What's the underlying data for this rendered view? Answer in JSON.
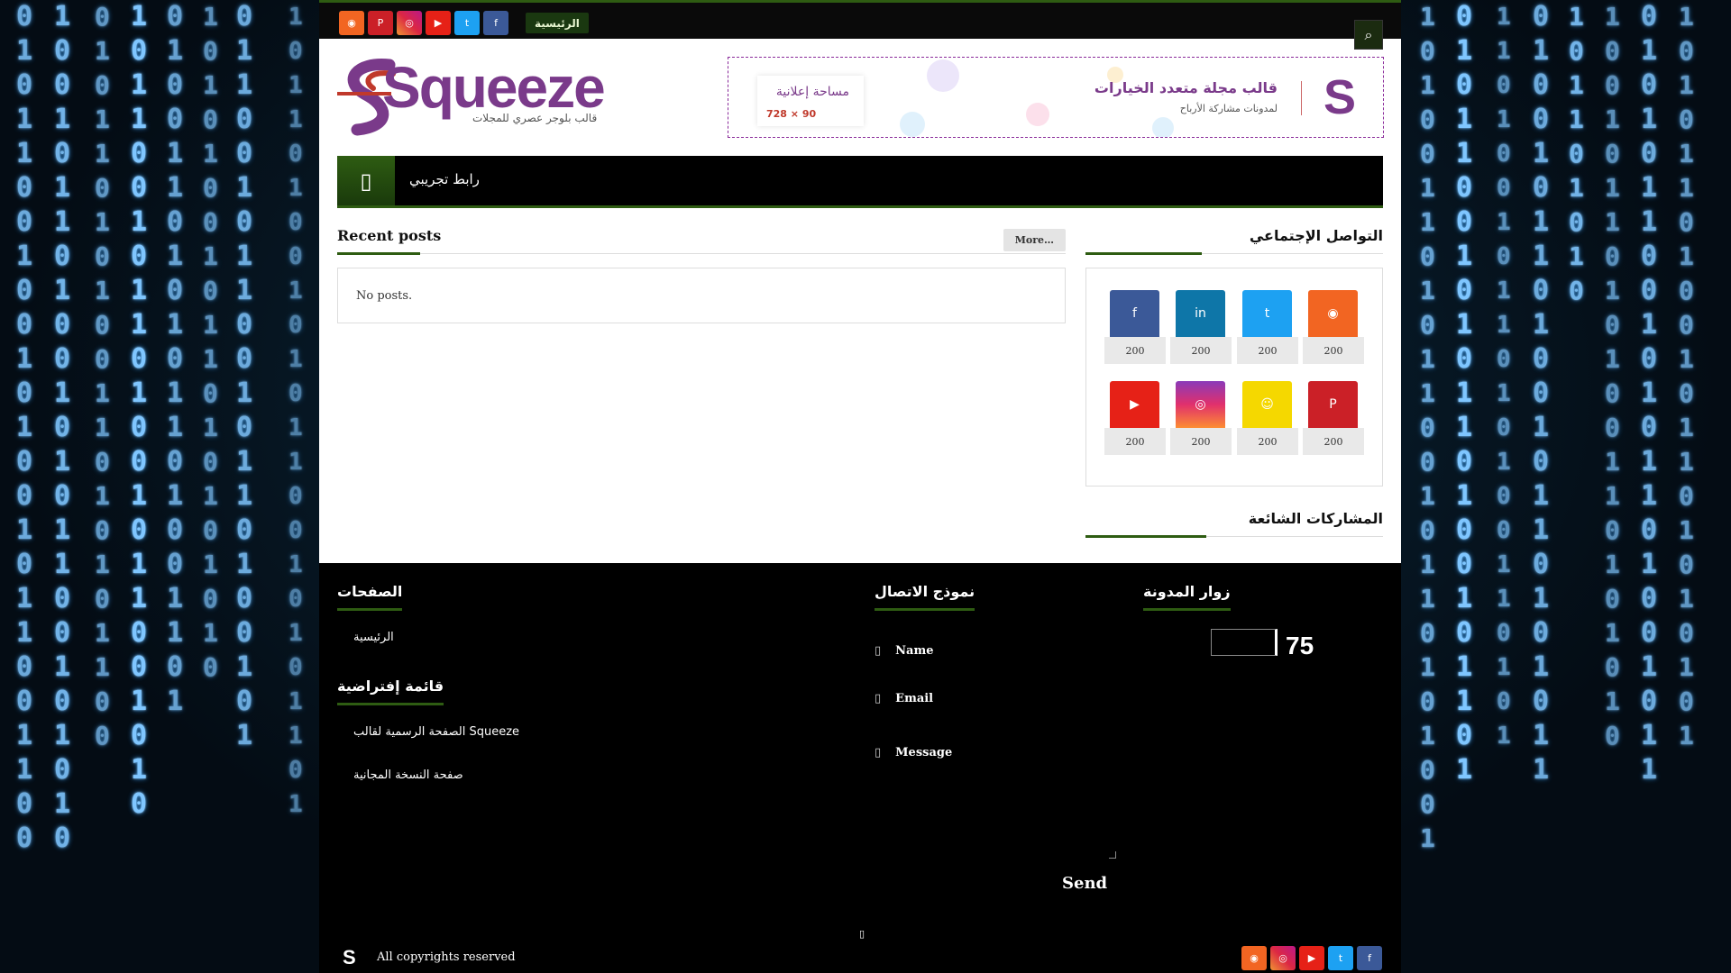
{
  "colors": {
    "accent": "#2e5c12",
    "brand": "#7a3a8a",
    "rss": "#f26522",
    "pinterest": "#cb2027",
    "instagram": "#c13584",
    "youtube": "#e62117",
    "twitter": "#1da1f2",
    "facebook": "#3b5998",
    "linkedin": "#0e76a8",
    "snapchat": "#ffdd00"
  },
  "topbar": {
    "home_label": "الرئيسية",
    "search_icon": "search-icon",
    "social_icons": [
      "rss-icon",
      "pinterest-icon",
      "instagram-icon",
      "youtube-icon",
      "twitter-icon",
      "facebook-icon"
    ]
  },
  "header": {
    "logo_word": "Squeeze",
    "logo_tagline": "قالب بلوجر عصري للمجلات",
    "banner": {
      "title": "قالب مجلة متعدد الخيارات",
      "subtitle": "لمدونات مشاركة الأرباح",
      "ad_label": "مساحة إعلانية",
      "ad_size": "728 × 90",
      "logo_letter": "S"
    }
  },
  "nav": {
    "link_label": "رابط تجريبي"
  },
  "recent": {
    "title": "Recent posts",
    "more_label": "More…",
    "empty_text": "No posts."
  },
  "sidebar": {
    "social_title": "التواصل الإجتماعي",
    "social_items": [
      {
        "icon": "facebook-icon",
        "count": "200"
      },
      {
        "icon": "linkedin-icon",
        "count": "200"
      },
      {
        "icon": "twitter-icon",
        "count": "200"
      },
      {
        "icon": "rss-icon",
        "count": "200"
      },
      {
        "icon": "youtube-icon",
        "count": "200"
      },
      {
        "icon": "instagram-icon",
        "count": "200"
      },
      {
        "icon": "snapchat-icon",
        "count": "200"
      },
      {
        "icon": "pinterest-icon",
        "count": "200"
      }
    ],
    "popular_title": "المشاركات الشائعة"
  },
  "footer": {
    "pages_title": "الصفحات",
    "pages_home": "الرئيسية",
    "menu_title": "قائمة إفتراضية",
    "menu_link1": "الصفحة الرسمية لقالب Squeeze",
    "menu_link2": "صفحة النسخة المجانية",
    "contact_title": "نموذج الاتصال",
    "name_label": "Name",
    "email_label": "Email",
    "message_label": "Message",
    "send_label": "Send",
    "visitors_title": "زوار المدونة",
    "visitors_count": "75",
    "copyright": "All copyrights reserved",
    "social_icons": [
      "rss-icon",
      "instagram-icon",
      "youtube-icon",
      "twitter-icon",
      "facebook-icon"
    ]
  }
}
